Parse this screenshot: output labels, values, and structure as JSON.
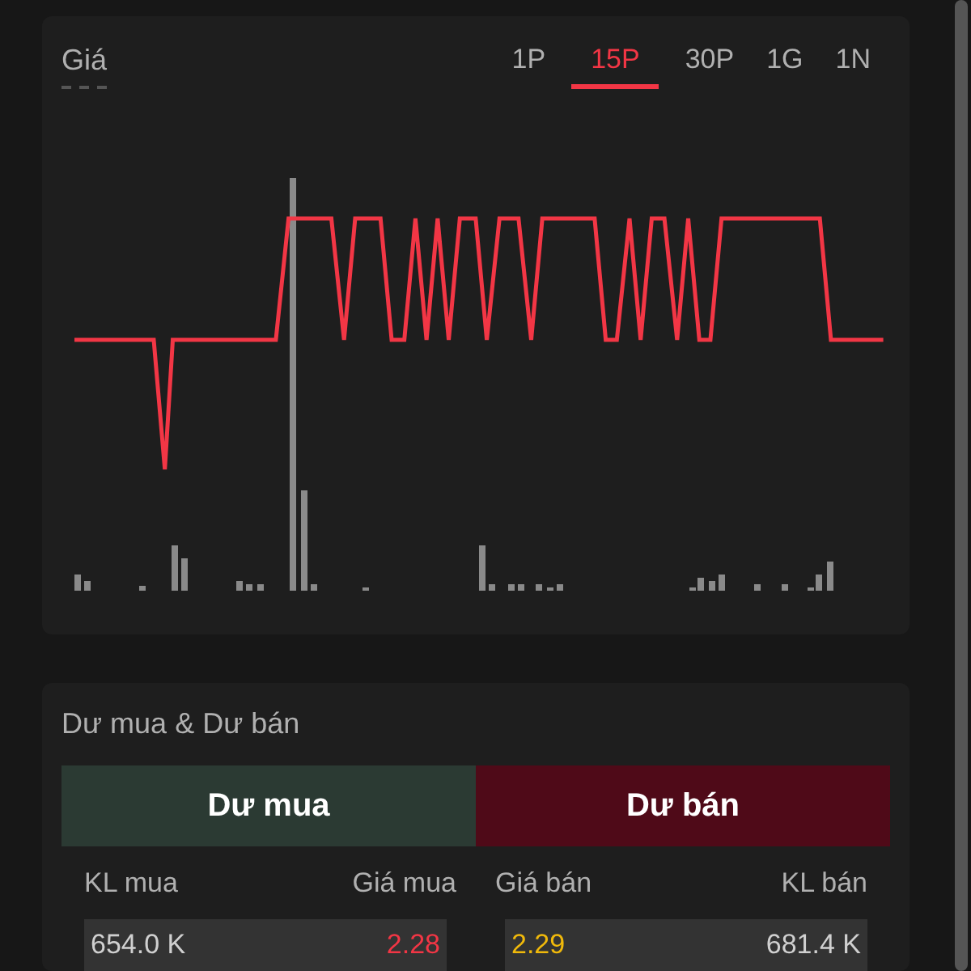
{
  "price_card": {
    "title": "Giá",
    "tabs": [
      {
        "label": "1P",
        "selected": false
      },
      {
        "label": "15P",
        "selected": true
      },
      {
        "label": "30P",
        "selected": false
      },
      {
        "label": "1G",
        "selected": false
      },
      {
        "label": "1N",
        "selected": false
      }
    ]
  },
  "order_book": {
    "title": "Dư mua & Dư bán",
    "buy_header": "Dư mua",
    "sell_header": "Dư bán",
    "columns": [
      "KL mua",
      "Giá mua",
      "Giá bán",
      "KL bán"
    ],
    "rows": [
      {
        "buy_volume": "654.0 K",
        "buy_price": {
          "text": "2.28",
          "color": "#f23645"
        },
        "sell_price": {
          "text": "2.29",
          "color": "#f0b90b"
        },
        "sell_volume": "681.4 K"
      }
    ]
  }
}
